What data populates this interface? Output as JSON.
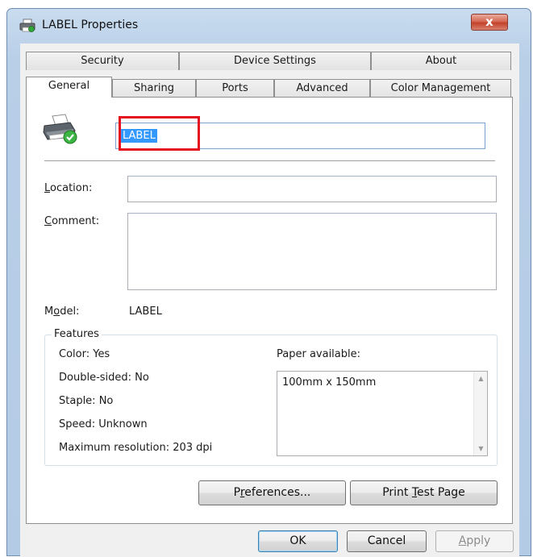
{
  "window": {
    "title": "LABEL Properties",
    "close_label": "x"
  },
  "tabs": {
    "security": "Security",
    "device_settings": "Device Settings",
    "about": "About",
    "general": "General",
    "sharing": "Sharing",
    "ports": "Ports",
    "advanced": "Advanced",
    "color_management": "Color Management"
  },
  "general": {
    "printer_name": "LABEL",
    "location_label": {
      "accel": "L",
      "rest": "ocation:"
    },
    "location_value": "",
    "comment_label": {
      "accel": "C",
      "rest": "omment:"
    },
    "comment_value": "",
    "model_label": {
      "pre": "M",
      "accel": "o",
      "rest": "del:"
    },
    "model_value": "LABEL"
  },
  "features": {
    "legend": "Features",
    "color": "Color: Yes",
    "double_sided": "Double-sided: No",
    "staple": "Staple: No",
    "speed": "Speed: Unknown",
    "max_resolution": "Maximum resolution: 203 dpi",
    "paper_label": "Paper available:",
    "paper_items": [
      "100mm x 150mm"
    ]
  },
  "buttons": {
    "preferences": {
      "pre": "P",
      "accel": "r",
      "rest": "eferences..."
    },
    "print_test_page": {
      "pre": "Print ",
      "accel": "T",
      "rest": "est Page"
    },
    "ok": "OK",
    "cancel": "Cancel",
    "apply": {
      "accel": "A",
      "rest": "pply"
    }
  },
  "colors": {
    "highlight_box": "#e5121f",
    "selection": "#3399ff",
    "close_button": "#c4412a"
  },
  "icons": [
    "printer-icon",
    "printer-check-icon",
    "close-icon",
    "scroll-up-icon",
    "scroll-down-icon"
  ]
}
